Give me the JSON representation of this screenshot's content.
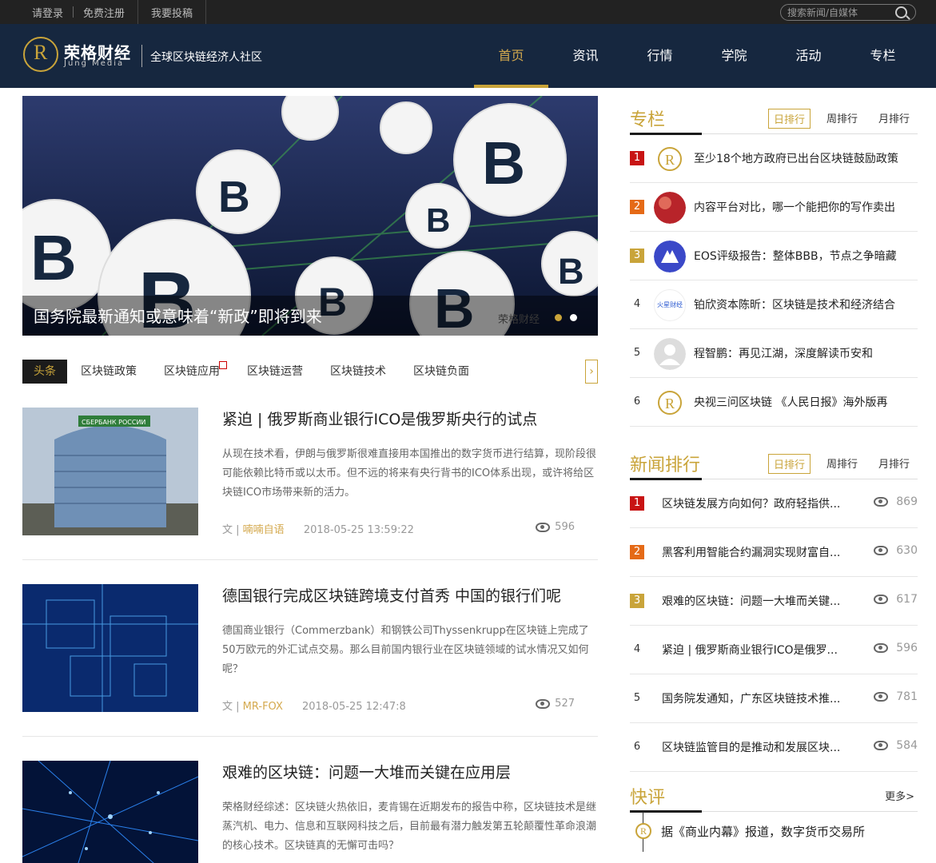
{
  "topbar": {
    "login": "请登录",
    "register": "免费注册",
    "submit": "我要投稿",
    "search_placeholder": "搜索新闻/自媒体"
  },
  "header": {
    "brand": "荣格财经",
    "brand_sub": "Jung Media",
    "tagline": "全球区块链经济人社区",
    "nav": [
      "首页",
      "资讯",
      "行情",
      "学院",
      "活动",
      "专栏"
    ]
  },
  "hero": {
    "caption": "国务院最新通知或意味着“新政”即将到来",
    "watermark": "荣格财经"
  },
  "tabs": [
    "头条",
    "区块链政策",
    "区块链应用",
    "区块链运营",
    "区块链技术",
    "区块链负面"
  ],
  "articles": [
    {
      "title": "紧迫 | 俄罗斯商业银行ICO是俄罗斯央行的试点",
      "summary": "从现在技术看，伊朗与俄罗斯很难直接用本国推出的数字货币进行结算，现阶段很可能依赖比特币或以太币。但不远的将来有央行背书的ICO体系出现，或许将给区块链ICO市场带来新的活力。",
      "prefix": "文 |",
      "author": "喃喃自语",
      "date": "2018-05-25 13:59:22",
      "views": "596"
    },
    {
      "title": "德国银行完成区块链跨境支付首秀 中国的银行们呢",
      "summary": "德国商业银行（Commerzbank）和钢铁公司Thyssenkrupp在区块链上完成了50万欧元的外汇试点交易。那么目前国内银行业在区块链领域的试水情况又如何呢？",
      "prefix": "文 |",
      "author": "MR-FOX",
      "date": "2018-05-25 12:47:8",
      "views": "527"
    },
    {
      "title": "艰难的区块链：问题一大堆而关键在应用层",
      "summary": "荣格财经综述：区块链火热依旧，麦肯锡在近期发布的报告中称，区块链技术是继蒸汽机、电力、信息和互联网科技之后，目前最有潜力触发第五轮颠覆性革命浪潮的核心技术。区块链真的无懈可击吗？"
    }
  ],
  "column": {
    "title": "专栏",
    "ranks": [
      "日排行",
      "周排行",
      "月排行"
    ],
    "items": [
      {
        "rank": "1",
        "text": "至少18个地方政府已出台区块链鼓励政策"
      },
      {
        "rank": "2",
        "text": "内容平台对比，哪一个能把你的写作卖出"
      },
      {
        "rank": "3",
        "text": "EOS评级报告：整体BBB，节点之争暗藏"
      },
      {
        "rank": "4",
        "text": "铂欣资本陈昕：区块链是技术和经济结合",
        "avatar_text": "火星财经"
      },
      {
        "rank": "5",
        "text": "程智鹏：再见江湖，深度解读币安和"
      },
      {
        "rank": "6",
        "text": "央视三问区块链 《人民日报》海外版再"
      }
    ]
  },
  "news_rank": {
    "title": "新闻排行",
    "ranks": [
      "日排行",
      "周排行",
      "月排行"
    ],
    "items": [
      {
        "rank": "1",
        "text": "区块链发展方向如何？政府轻指供...",
        "views": "869"
      },
      {
        "rank": "2",
        "text": "黑客利用智能合约漏洞实现财富自...",
        "views": "630"
      },
      {
        "rank": "3",
        "text": "艰难的区块链：问题一大堆而关键...",
        "views": "617"
      },
      {
        "rank": "4",
        "text": "紧迫 | 俄罗斯商业银行ICO是俄罗...",
        "views": "596"
      },
      {
        "rank": "5",
        "text": "国务院发通知，广东区块链技术推...",
        "views": "781"
      },
      {
        "rank": "6",
        "text": "区块链监管目的是推动和发展区块...",
        "views": "584"
      }
    ]
  },
  "quick": {
    "title": "快评",
    "more": "更多>",
    "item": "据《商业内幕》报道，数字货币交易所"
  },
  "colors": {
    "accent": "#c9a43a",
    "navy": "#16273f",
    "rank1": "#c81414",
    "rank2": "#e56a17"
  }
}
